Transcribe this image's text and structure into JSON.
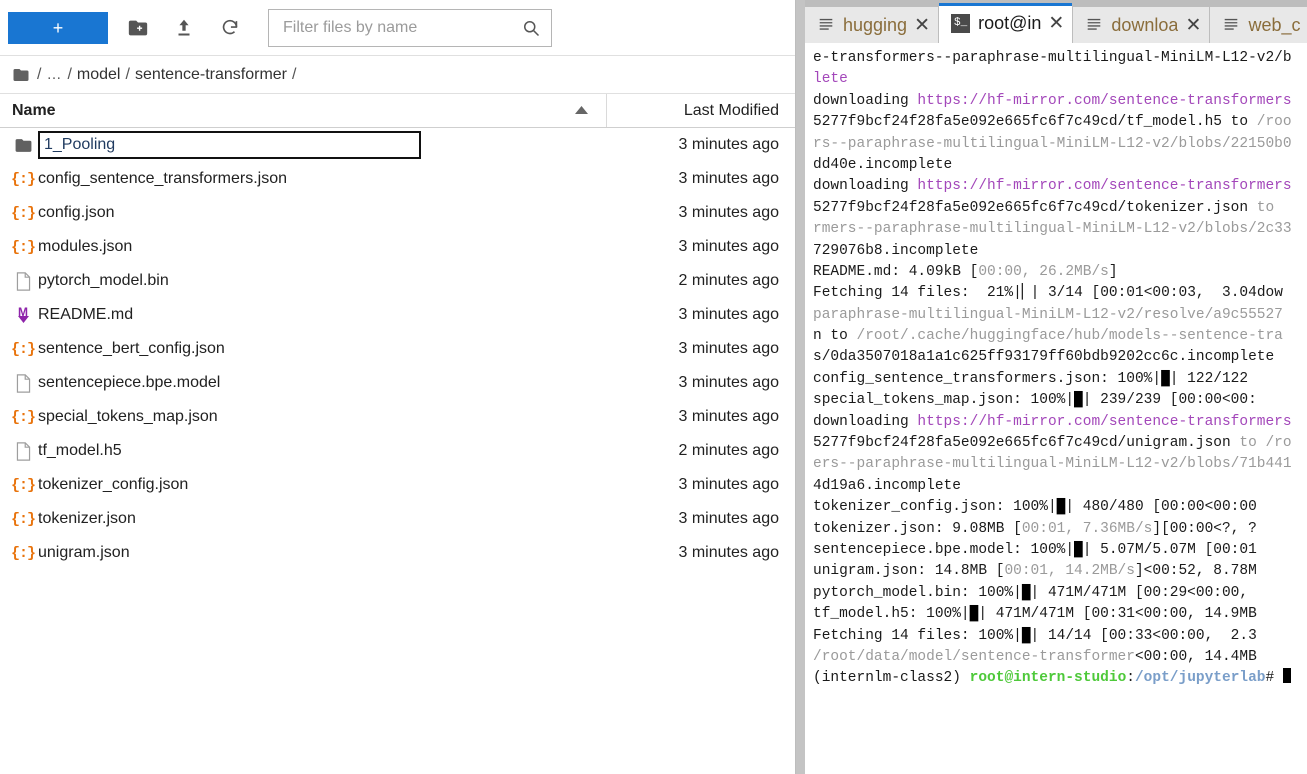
{
  "filebrowser": {
    "new_button_label": "+",
    "toolbar_icons": [
      "new-folder-icon",
      "upload-icon",
      "refresh-icon"
    ],
    "filter": {
      "placeholder": "Filter files by name",
      "value": ""
    },
    "breadcrumb": {
      "root_icon": "folder-icon",
      "sep": "/",
      "ellipsis": "…",
      "items": [
        "model",
        "sentence-transformer"
      ]
    },
    "columns": {
      "name": "Name",
      "last_modified": "Last Modified",
      "sort": "ascending"
    },
    "rename": {
      "active": true,
      "value": "1_Pooling"
    },
    "rows": [
      {
        "name": "1_Pooling",
        "icon": "folder-icon",
        "modified": "3 minutes ago",
        "editing": true
      },
      {
        "name": "config_sentence_transformers.json",
        "icon": "json-icon",
        "modified": "3 minutes ago"
      },
      {
        "name": "config.json",
        "icon": "json-icon",
        "modified": "3 minutes ago"
      },
      {
        "name": "modules.json",
        "icon": "json-icon",
        "modified": "3 minutes ago"
      },
      {
        "name": "pytorch_model.bin",
        "icon": "file-icon",
        "modified": "2 minutes ago"
      },
      {
        "name": "README.md",
        "icon": "markdown-icon",
        "modified": "3 minutes ago"
      },
      {
        "name": "sentence_bert_config.json",
        "icon": "json-icon",
        "modified": "3 minutes ago"
      },
      {
        "name": "sentencepiece.bpe.model",
        "icon": "file-icon",
        "modified": "3 minutes ago"
      },
      {
        "name": "special_tokens_map.json",
        "icon": "json-icon",
        "modified": "3 minutes ago"
      },
      {
        "name": "tf_model.h5",
        "icon": "file-icon",
        "modified": "2 minutes ago"
      },
      {
        "name": "tokenizer_config.json",
        "icon": "json-icon",
        "modified": "3 minutes ago"
      },
      {
        "name": "tokenizer.json",
        "icon": "json-icon",
        "modified": "3 minutes ago"
      },
      {
        "name": "unigram.json",
        "icon": "json-icon",
        "modified": "3 minutes ago"
      }
    ]
  },
  "dock": {
    "tabs": [
      {
        "label": "hugging",
        "icon": "text-file-icon",
        "active": false,
        "close": "✕"
      },
      {
        "label": "root@in",
        "icon": "terminal-icon",
        "active": true,
        "close": "✕"
      },
      {
        "label": "downloa",
        "icon": "text-file-icon",
        "active": false,
        "close": "✕"
      },
      {
        "label": "web_c",
        "icon": "text-file-icon",
        "active": false,
        "close": "✕"
      }
    ]
  },
  "terminal": {
    "colors": {
      "url": "#a347ba",
      "path": "#9a9a9a",
      "user_host": "#4ec93a",
      "cwd": "#7a9ec9",
      "background": "#ffffff",
      "foreground": "#1a1a1a"
    },
    "prompt": {
      "env": "(internlm-class2)",
      "user_host": "root@intern-studio",
      "colon": ":",
      "cwd": "/opt/jupyterlab",
      "symbol": "# "
    },
    "lines": [
      [
        {
          "t": "e-transformers--paraphrase-multilingual-MiniLM-L12-v2/b"
        }
      ],
      [
        {
          "t": "lete",
          "c": "url"
        }
      ],
      [
        {
          "t": "downloading "
        },
        {
          "t": "https://hf-mirror.com/sentence-transformers",
          "c": "url"
        }
      ],
      [
        {
          "t": "5277f9bcf24f28fa5e092e665fc6f7c49cd/tf_model.h5"
        },
        {
          "t": " to "
        },
        {
          "t": "/roo",
          "c": "path"
        }
      ],
      [
        {
          "t": "rs--paraphrase-multilingual-MiniLM-L12-v2/blobs/22150b0",
          "c": "path"
        }
      ],
      [
        {
          "t": "dd40e.incomplete"
        }
      ],
      [
        {
          "t": "downloading "
        },
        {
          "t": "https://hf-mirror.com/sentence-transformers",
          "c": "url"
        }
      ],
      [
        {
          "t": "5277f9bcf24f28fa5e092e665fc6f7c49cd/tokenizer.json"
        },
        {
          "t": " to ",
          "c": "path"
        }
      ],
      [
        {
          "t": "rmers--paraphrase-multilingual-MiniLM-L12-v2/blobs/2c33",
          "c": "path"
        }
      ],
      [
        {
          "t": "729076b8.incomplete"
        }
      ],
      [
        {
          "t": "README.md: 4.09kB ["
        },
        {
          "t": "00:00, 26.2MB/s",
          "c": "path"
        },
        {
          "t": "]"
        }
      ],
      [
        {
          "t": "Fetching 14 files:  21%|"
        },
        {
          "t": "▏",
          "c": "bar"
        },
        {
          "t": "| 3/14 [00:01<00:03,  3.04dow"
        }
      ],
      [
        {
          "t": "paraphrase-multilingual-MiniLM-L12-v2/resolve/a9c55527",
          "c": "path"
        }
      ],
      [
        {
          "t": "n to "
        },
        {
          "t": "/root/.cache/huggingface/hub/models--sentence-tra",
          "c": "path"
        }
      ],
      [
        {
          "t": "s/0da3507018a1a1c625ff93179ff60bdb9202cc6c.incomplete"
        }
      ],
      [
        {
          "t": "config_sentence_transformers.json: 100%|"
        },
        {
          "t": "█",
          "c": "bar"
        },
        {
          "t": "| 122/122"
        }
      ],
      [
        {
          "t": "special_tokens_map.json: 100%|"
        },
        {
          "t": "█",
          "c": "bar"
        },
        {
          "t": "| 239/239 [00:00<00:"
        }
      ],
      [
        {
          "t": "downloading "
        },
        {
          "t": "https://hf-mirror.com/sentence-transformers",
          "c": "url"
        }
      ],
      [
        {
          "t": "5277f9bcf24f28fa5e092e665fc6f7c49cd/unigram.json"
        },
        {
          "t": " to ",
          "c": "path"
        },
        {
          "t": "/ro",
          "c": "path"
        }
      ],
      [
        {
          "t": "ers--paraphrase-multilingual-MiniLM-L12-v2/blobs/71b441",
          "c": "path"
        }
      ],
      [
        {
          "t": "4d19a6.incomplete"
        }
      ],
      [
        {
          "t": "tokenizer_config.json: 100%|"
        },
        {
          "t": "█",
          "c": "bar"
        },
        {
          "t": "| 480/480 [00:00<00:00"
        }
      ],
      [
        {
          "t": "tokenizer.json: 9.08MB ["
        },
        {
          "t": "00:01, 7.36MB/s",
          "c": "path"
        },
        {
          "t": "][00:00<?, ?"
        }
      ],
      [
        {
          "t": "sentencepiece.bpe.model: 100%|"
        },
        {
          "t": "█",
          "c": "bar"
        },
        {
          "t": "| 5.07M/5.07M [00:01"
        }
      ],
      [
        {
          "t": "unigram.json: 14.8MB ["
        },
        {
          "t": "00:01, 14.2MB/s",
          "c": "path"
        },
        {
          "t": "]<00:52, 8.78M"
        }
      ],
      [
        {
          "t": "pytorch_model.bin: 100%|"
        },
        {
          "t": "█",
          "c": "bar"
        },
        {
          "t": "| 471M/471M [00:29<00:00,"
        }
      ],
      [
        {
          "t": "tf_model.h5: 100%|"
        },
        {
          "t": "█",
          "c": "bar"
        },
        {
          "t": "| 471M/471M [00:31<00:00, 14.9MB"
        }
      ],
      [
        {
          "t": "Fetching 14 files: 100%|"
        },
        {
          "t": "█",
          "c": "bar"
        },
        {
          "t": "| 14/14 [00:33<00:00,  2.3"
        }
      ],
      [
        {
          "t": "/root/data/model/sentence-transformer",
          "c": "path"
        },
        {
          "t": "<00:00, 14.4MB"
        }
      ]
    ]
  }
}
